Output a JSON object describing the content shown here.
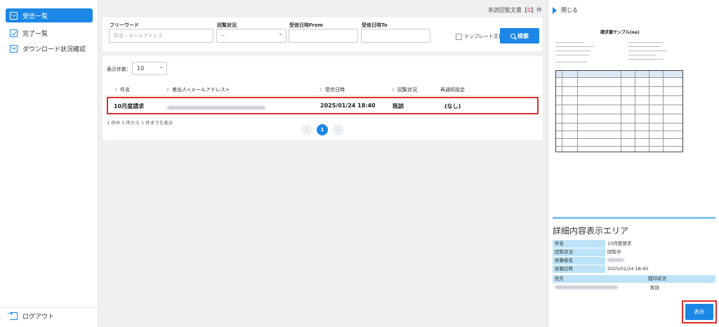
{
  "sidebar": {
    "items": [
      {
        "label": "受信一覧",
        "icon": "mail-icon",
        "active": true
      },
      {
        "label": "完了一覧",
        "icon": "check-box-icon",
        "active": false
      },
      {
        "label": "ダウンロード状況確認",
        "icon": "download-icon",
        "active": false
      }
    ],
    "logout": "ログアウト"
  },
  "header": {
    "unread_label": "未読回覧文書【",
    "unread_count": "0",
    "unread_suffix": "】件"
  },
  "search": {
    "freeword_label": "フリーワード",
    "freeword_placeholder": "件名・メールアドレス",
    "status_label": "回覧状況",
    "status_value": "--",
    "from_label": "受信日時From",
    "to_label": "受信日時To",
    "template_label": "テンプレート文書",
    "search_button": "検索"
  },
  "list": {
    "per_page_label": "表示件数：",
    "per_page_value": "10",
    "columns": [
      "件名",
      "差出人<メールアドレス>",
      "受信日時",
      "回覧状況",
      "再通知設定"
    ],
    "rows": [
      {
        "subject": "10月度請求",
        "received": "2025/01/24 18:40",
        "status": "既読",
        "renotify": "(なし)"
      }
    ],
    "count_text": "1 件中 1 件から 1 件までを表示",
    "pagination": {
      "prev": "‹",
      "current": "1",
      "next": "›"
    }
  },
  "panel": {
    "close_label": "閉じる",
    "preview": {
      "doc_title": "請求書サンプル(no)"
    },
    "detail_title": "詳細内容表示エリア",
    "details": [
      {
        "key": "件名",
        "value": "10月度請求"
      },
      {
        "key": "回覧状況",
        "value": "回覧中"
      },
      {
        "key": "依頼者名",
        "value": ""
      },
      {
        "key": "依頼日時",
        "value": "2025/01/24 18:40"
      }
    ],
    "dest_header": "宛先",
    "dest_status_header": "閲印状況",
    "dest_status": "既読",
    "show_button": "表示"
  },
  "colors": {
    "accent": "#1b87e6",
    "highlight": "#d9312c",
    "label_bg": "#bde3f8"
  }
}
